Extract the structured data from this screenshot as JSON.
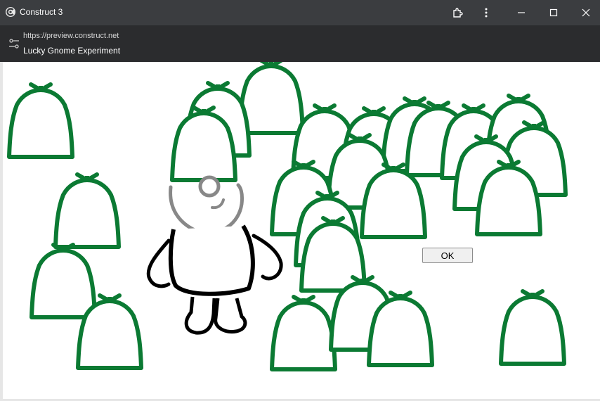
{
  "window": {
    "title": "Construct 3",
    "icons": {
      "app": "construct-logo-icon",
      "extensions": "puzzle-icon",
      "menu": "more-vert-icon",
      "minimize": "minimize-icon",
      "maximize": "maximize-icon",
      "close": "close-icon"
    }
  },
  "address_bar": {
    "url": "https://preview.construct.net",
    "page_title": "Lucky Gnome Experiment",
    "icon": "site-settings-icon"
  },
  "game": {
    "ok_button_label": "OK",
    "colors": {
      "bag": "#0b7a33",
      "gnome_head": "#888888",
      "gnome_body": "#000000",
      "background": "#ffffff"
    }
  }
}
